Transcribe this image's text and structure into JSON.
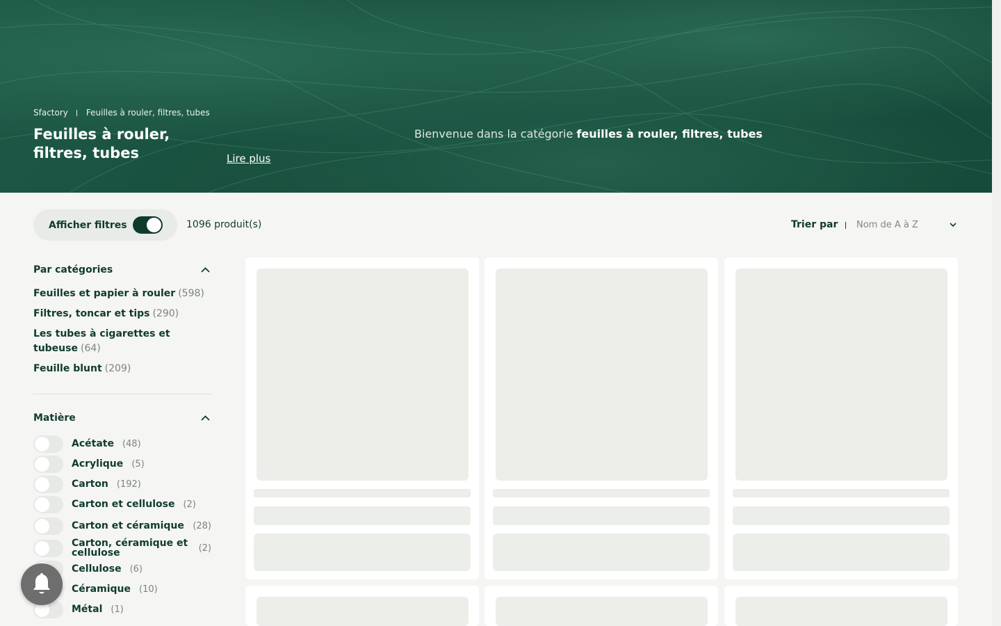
{
  "hero": {
    "breadcrumb": [
      "Sfactory",
      "Feuilles à rouler, filtres, tubes"
    ],
    "title": "Feuilles à rouler, filtres, tubes",
    "read_more": "Lire plus",
    "intro_prefix": "Bienvenue dans la catégorie ",
    "intro_bold": "feuilles à rouler, filtres, tubes"
  },
  "toolbar": {
    "filters_label": "Afficher filtres",
    "filters_on": true,
    "product_count": "1096 produit(s)",
    "sort_label": "Trier par",
    "sort_value": "Nom de A à Z"
  },
  "sidebar": {
    "categories_title": "Par catégories",
    "categories": [
      {
        "label": "Feuilles et papier à rouler",
        "count": "(598)"
      },
      {
        "label": "Filtres, toncar et tips",
        "count": "(290)"
      },
      {
        "label": "Les tubes à cigarettes et tubeuse",
        "count": "(64)"
      },
      {
        "label": "Feuille blunt",
        "count": "(209)"
      }
    ],
    "material_title": "Matière",
    "materials": [
      {
        "label": "Acétate",
        "count": "(48)"
      },
      {
        "label": "Acrylique",
        "count": "(5)"
      },
      {
        "label": "Carton",
        "count": "(192)"
      },
      {
        "label": "Carton et cellulose",
        "count": "(2)"
      },
      {
        "label": "Carton et céramique",
        "count": "(28)"
      },
      {
        "label": "Carton, céramique et cellulose",
        "count": "(2)"
      },
      {
        "label": "Cellulose",
        "count": "(6)"
      },
      {
        "label": "Céramique",
        "count": "(10)"
      },
      {
        "label": "Métal",
        "count": "(1)"
      }
    ]
  },
  "icons": {
    "chevron": "chevron-down-icon",
    "collapse": "chevron-up-icon",
    "notification": "bell-icon"
  },
  "colors": {
    "brand_dark": "#0f3b2e",
    "hero_green": "#1a5443",
    "skeleton": "#edeee9",
    "background": "#f5f5f3"
  }
}
